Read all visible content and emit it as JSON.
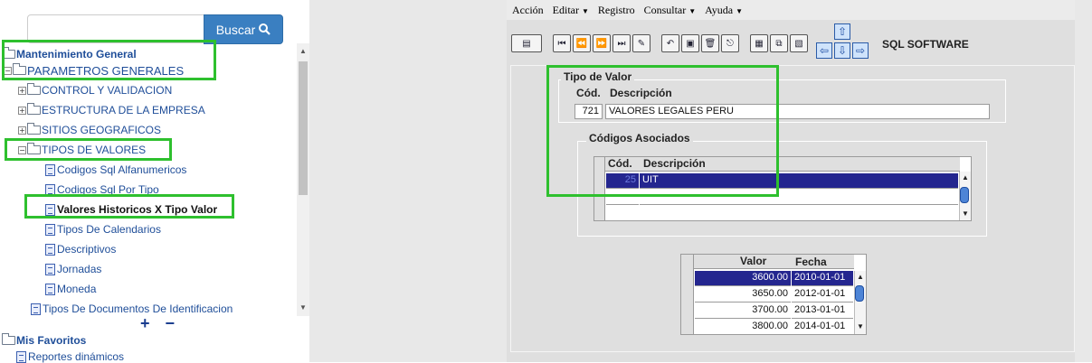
{
  "search": {
    "placeholder": "",
    "button_label": "Buscar"
  },
  "tree": {
    "items": [
      {
        "label": "Mantenimiento General"
      },
      {
        "label": "PARAMETROS GENERALES"
      },
      {
        "label": "CONTROL Y VALIDACION"
      },
      {
        "label": "ESTRUCTURA DE LA EMPRESA"
      },
      {
        "label": "SITIOS GEOGRAFICOS"
      },
      {
        "label": "TIPOS DE VALORES"
      },
      {
        "label": "Codigos Sql Alfanumericos"
      },
      {
        "label": "Codigos Sql Por Tipo"
      },
      {
        "label": "Valores Historicos X Tipo Valor"
      },
      {
        "label": "Tipos De Calendarios"
      },
      {
        "label": "Descriptivos"
      },
      {
        "label": "Jornadas"
      },
      {
        "label": "Moneda"
      },
      {
        "label": "Tipos De Documentos De Identificacion"
      }
    ],
    "expand_collapse": "+ −",
    "favorites": {
      "label": "Mis Favoritos",
      "items": [
        {
          "label": "Reportes dinámicos"
        }
      ]
    }
  },
  "menu": {
    "items": [
      "Acción",
      "Editar",
      "Registro",
      "Consultar",
      "Ayuda"
    ]
  },
  "brand": "SQL SOFTWARE",
  "form": {
    "tipo_valor": {
      "legend": "Tipo de Valor",
      "cod_label": "Cód.",
      "desc_label": "Descripción",
      "cod_value": "721",
      "desc_value": "VALORES LEGALES PERU"
    },
    "codigos_asociados": {
      "legend": "Códigos Asociados",
      "col_cod": "Cód.",
      "col_desc": "Descripción",
      "rows": [
        {
          "cod": "25",
          "desc": "UIT"
        },
        {
          "cod": "",
          "desc": ""
        },
        {
          "cod": "",
          "desc": ""
        }
      ]
    },
    "valores": {
      "col_valor": "Valor",
      "col_fecha": "Fecha",
      "rows": [
        {
          "valor": "3600.00",
          "fecha": "2010-01-01"
        },
        {
          "valor": "3650.00",
          "fecha": "2012-01-01"
        },
        {
          "valor": "3700.00",
          "fecha": "2013-01-01"
        },
        {
          "valor": "3800.00",
          "fecha": "2014-01-01"
        }
      ]
    }
  }
}
